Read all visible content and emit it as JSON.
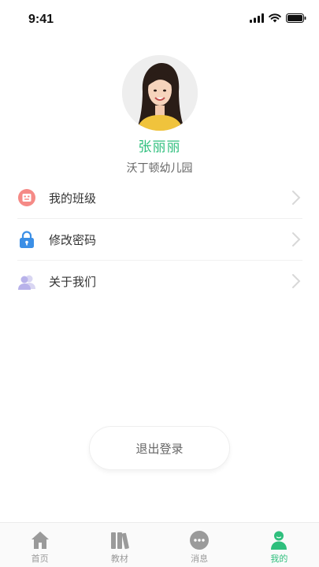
{
  "status_bar": {
    "time": "9:41"
  },
  "profile": {
    "name": "张丽丽",
    "school": "沃丁顿幼儿园"
  },
  "menu": {
    "items": [
      {
        "label": "我的班级",
        "icon": "class-icon"
      },
      {
        "label": "修改密码",
        "icon": "lock-icon"
      },
      {
        "label": "关于我们",
        "icon": "people-icon"
      }
    ]
  },
  "logout": {
    "label": "退出登录"
  },
  "tabbar": {
    "items": [
      {
        "label": "首页",
        "icon": "home-icon"
      },
      {
        "label": "教材",
        "icon": "books-icon"
      },
      {
        "label": "消息",
        "icon": "message-icon"
      },
      {
        "label": "我的",
        "icon": "profile-icon"
      }
    ],
    "active_index": 3
  },
  "colors": {
    "accent": "#2fbf7d",
    "muted": "#999999"
  }
}
